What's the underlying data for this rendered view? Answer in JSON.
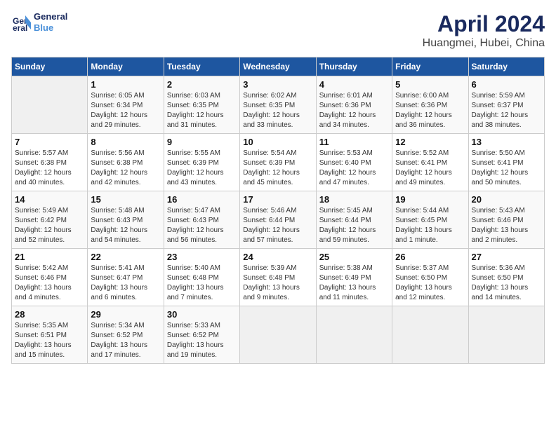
{
  "header": {
    "logo_line1": "General",
    "logo_line2": "Blue",
    "month": "April 2024",
    "location": "Huangmei, Hubei, China"
  },
  "columns": [
    "Sunday",
    "Monday",
    "Tuesday",
    "Wednesday",
    "Thursday",
    "Friday",
    "Saturday"
  ],
  "weeks": [
    [
      {
        "day": "",
        "info": ""
      },
      {
        "day": "1",
        "info": "Sunrise: 6:05 AM\nSunset: 6:34 PM\nDaylight: 12 hours\nand 29 minutes."
      },
      {
        "day": "2",
        "info": "Sunrise: 6:03 AM\nSunset: 6:35 PM\nDaylight: 12 hours\nand 31 minutes."
      },
      {
        "day": "3",
        "info": "Sunrise: 6:02 AM\nSunset: 6:35 PM\nDaylight: 12 hours\nand 33 minutes."
      },
      {
        "day": "4",
        "info": "Sunrise: 6:01 AM\nSunset: 6:36 PM\nDaylight: 12 hours\nand 34 minutes."
      },
      {
        "day": "5",
        "info": "Sunrise: 6:00 AM\nSunset: 6:36 PM\nDaylight: 12 hours\nand 36 minutes."
      },
      {
        "day": "6",
        "info": "Sunrise: 5:59 AM\nSunset: 6:37 PM\nDaylight: 12 hours\nand 38 minutes."
      }
    ],
    [
      {
        "day": "7",
        "info": "Sunrise: 5:57 AM\nSunset: 6:38 PM\nDaylight: 12 hours\nand 40 minutes."
      },
      {
        "day": "8",
        "info": "Sunrise: 5:56 AM\nSunset: 6:38 PM\nDaylight: 12 hours\nand 42 minutes."
      },
      {
        "day": "9",
        "info": "Sunrise: 5:55 AM\nSunset: 6:39 PM\nDaylight: 12 hours\nand 43 minutes."
      },
      {
        "day": "10",
        "info": "Sunrise: 5:54 AM\nSunset: 6:39 PM\nDaylight: 12 hours\nand 45 minutes."
      },
      {
        "day": "11",
        "info": "Sunrise: 5:53 AM\nSunset: 6:40 PM\nDaylight: 12 hours\nand 47 minutes."
      },
      {
        "day": "12",
        "info": "Sunrise: 5:52 AM\nSunset: 6:41 PM\nDaylight: 12 hours\nand 49 minutes."
      },
      {
        "day": "13",
        "info": "Sunrise: 5:50 AM\nSunset: 6:41 PM\nDaylight: 12 hours\nand 50 minutes."
      }
    ],
    [
      {
        "day": "14",
        "info": "Sunrise: 5:49 AM\nSunset: 6:42 PM\nDaylight: 12 hours\nand 52 minutes."
      },
      {
        "day": "15",
        "info": "Sunrise: 5:48 AM\nSunset: 6:43 PM\nDaylight: 12 hours\nand 54 minutes."
      },
      {
        "day": "16",
        "info": "Sunrise: 5:47 AM\nSunset: 6:43 PM\nDaylight: 12 hours\nand 56 minutes."
      },
      {
        "day": "17",
        "info": "Sunrise: 5:46 AM\nSunset: 6:44 PM\nDaylight: 12 hours\nand 57 minutes."
      },
      {
        "day": "18",
        "info": "Sunrise: 5:45 AM\nSunset: 6:44 PM\nDaylight: 12 hours\nand 59 minutes."
      },
      {
        "day": "19",
        "info": "Sunrise: 5:44 AM\nSunset: 6:45 PM\nDaylight: 13 hours\nand 1 minute."
      },
      {
        "day": "20",
        "info": "Sunrise: 5:43 AM\nSunset: 6:46 PM\nDaylight: 13 hours\nand 2 minutes."
      }
    ],
    [
      {
        "day": "21",
        "info": "Sunrise: 5:42 AM\nSunset: 6:46 PM\nDaylight: 13 hours\nand 4 minutes."
      },
      {
        "day": "22",
        "info": "Sunrise: 5:41 AM\nSunset: 6:47 PM\nDaylight: 13 hours\nand 6 minutes."
      },
      {
        "day": "23",
        "info": "Sunrise: 5:40 AM\nSunset: 6:48 PM\nDaylight: 13 hours\nand 7 minutes."
      },
      {
        "day": "24",
        "info": "Sunrise: 5:39 AM\nSunset: 6:48 PM\nDaylight: 13 hours\nand 9 minutes."
      },
      {
        "day": "25",
        "info": "Sunrise: 5:38 AM\nSunset: 6:49 PM\nDaylight: 13 hours\nand 11 minutes."
      },
      {
        "day": "26",
        "info": "Sunrise: 5:37 AM\nSunset: 6:50 PM\nDaylight: 13 hours\nand 12 minutes."
      },
      {
        "day": "27",
        "info": "Sunrise: 5:36 AM\nSunset: 6:50 PM\nDaylight: 13 hours\nand 14 minutes."
      }
    ],
    [
      {
        "day": "28",
        "info": "Sunrise: 5:35 AM\nSunset: 6:51 PM\nDaylight: 13 hours\nand 15 minutes."
      },
      {
        "day": "29",
        "info": "Sunrise: 5:34 AM\nSunset: 6:52 PM\nDaylight: 13 hours\nand 17 minutes."
      },
      {
        "day": "30",
        "info": "Sunrise: 5:33 AM\nSunset: 6:52 PM\nDaylight: 13 hours\nand 19 minutes."
      },
      {
        "day": "",
        "info": ""
      },
      {
        "day": "",
        "info": ""
      },
      {
        "day": "",
        "info": ""
      },
      {
        "day": "",
        "info": ""
      }
    ]
  ]
}
